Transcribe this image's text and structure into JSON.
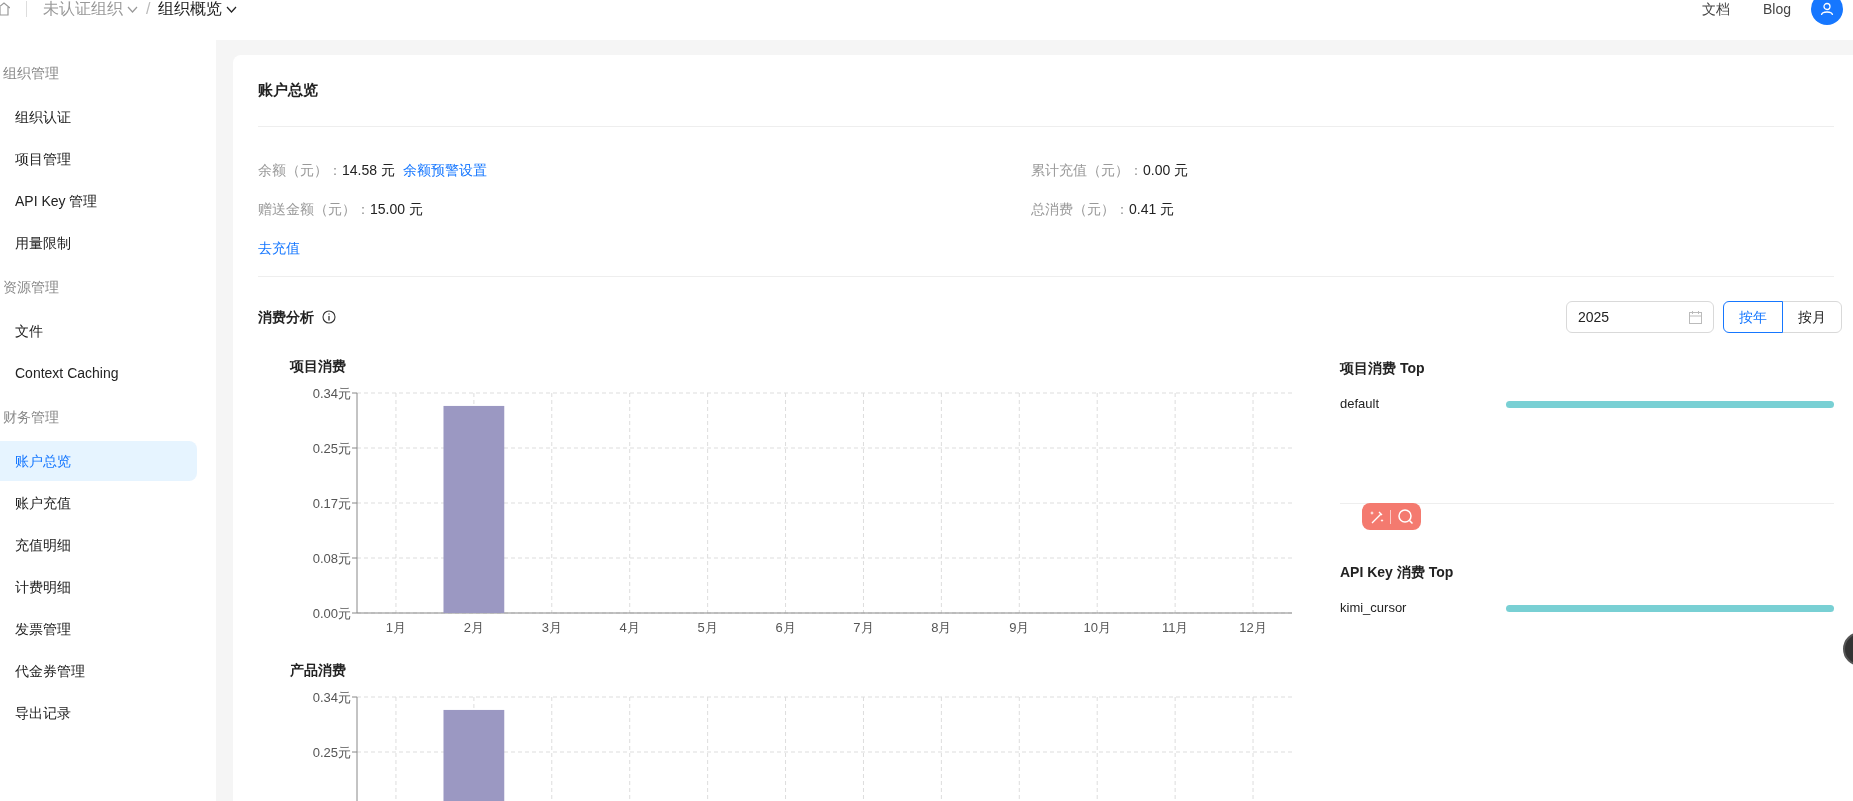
{
  "topbar": {
    "breadcrumb": [
      {
        "label": "未认证组织",
        "current": false
      },
      {
        "label": "组织概览",
        "current": true
      }
    ],
    "separator": "/",
    "links": [
      "文档",
      "Blog"
    ]
  },
  "sidebar": {
    "sections": [
      {
        "heading": "组织管理",
        "items": [
          {
            "label": "组织认证",
            "selected": false
          },
          {
            "label": "项目管理",
            "selected": false
          },
          {
            "label": "API Key 管理",
            "selected": false
          },
          {
            "label": "用量限制",
            "selected": false
          }
        ]
      },
      {
        "heading": "资源管理",
        "items": [
          {
            "label": "文件",
            "selected": false
          },
          {
            "label": "Context Caching",
            "selected": false
          }
        ]
      },
      {
        "heading": "财务管理",
        "items": [
          {
            "label": "账户总览",
            "selected": true
          },
          {
            "label": "账户充值",
            "selected": false
          },
          {
            "label": "充值明细",
            "selected": false
          },
          {
            "label": "计费明细",
            "selected": false
          },
          {
            "label": "发票管理",
            "selected": false
          },
          {
            "label": "代金券管理",
            "selected": false
          },
          {
            "label": "导出记录",
            "selected": false
          }
        ]
      }
    ]
  },
  "overview": {
    "title": "账户总览",
    "fields": [
      {
        "label": "余额（元）：",
        "value": "14.58 元",
        "link": "余额预警设置"
      },
      {
        "label": "累计充值（元）：",
        "value": "0.00 元"
      },
      {
        "label": "赠送金额（元）：",
        "value": "15.00 元"
      },
      {
        "label": "总消费（元）：",
        "value": "0.41 元"
      }
    ],
    "recharge_link": "去充值"
  },
  "analysis": {
    "title": "消费分析",
    "year": "2025",
    "modes": [
      {
        "label": "按年",
        "selected": true
      },
      {
        "label": "按月",
        "selected": false
      }
    ],
    "charts": [
      {
        "title": "项目消费",
        "chart_data": {
          "type": "bar",
          "categories": [
            "1月",
            "2月",
            "3月",
            "4月",
            "5月",
            "6月",
            "7月",
            "8月",
            "9月",
            "10月",
            "11月",
            "12月"
          ],
          "grid": true,
          "series": [
            {
              "color": "#9b98c2",
              "values": [
                0,
                0.32,
                0,
                0,
                0,
                0,
                0,
                0,
                0,
                0,
                0,
                0
              ]
            }
          ],
          "ylim": [
            0,
            0.34
          ],
          "yticks": [
            {
              "value": 0,
              "label": "0.00元"
            },
            {
              "value": 0.085,
              "label": "0.08元"
            },
            {
              "value": 0.17,
              "label": "0.17元"
            },
            {
              "value": 0.255,
              "label": "0.25元"
            },
            {
              "value": 0.34,
              "label": "0.34元"
            }
          ]
        }
      },
      {
        "title": "产品消费",
        "chart_data": {
          "type": "bar",
          "grid": true,
          "series": [
            {
              "color": "#9b98c2",
              "values": [
                0,
                0.32,
                0,
                0,
                0,
                0,
                0,
                0,
                0,
                0,
                0,
                0
              ]
            }
          ],
          "ylim": [
            0,
            0.34
          ],
          "yticks": [
            {
              "value": 0.255,
              "label": "0.25元"
            },
            {
              "value": 0.34,
              "label": "0.34元"
            }
          ]
        }
      }
    ],
    "tops": [
      {
        "title": "项目消费 Top",
        "items": [
          {
            "name": "default",
            "level": 1
          }
        ]
      },
      {
        "title": "API Key 消费 Top",
        "items": [
          {
            "name": "kimi_cursor",
            "level": 1
          }
        ]
      }
    ]
  }
}
